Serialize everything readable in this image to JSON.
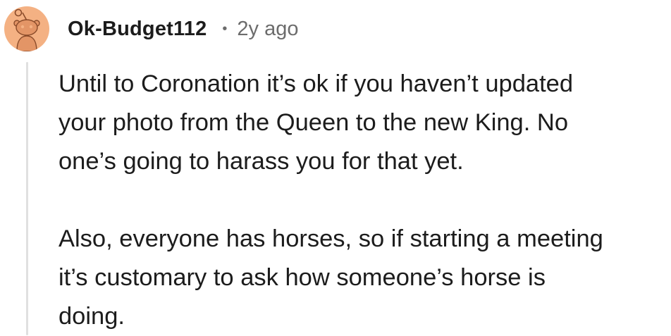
{
  "comment": {
    "author": "Ok-Budget112",
    "separator": "•",
    "timestamp": "2y ago",
    "avatar_icon": "reddit-snoo-avatar-icon",
    "avatar_color": "#f4b183",
    "paragraphs": [
      {
        "lines": [
          "Until to Coronation it’s ok if you haven’t updated",
          "your photo from the Queen to the new King. No",
          "one’s going to harass you for that yet."
        ]
      },
      {
        "lines": [
          "Also, everyone has horses, so if starting a meeting",
          "it’s customary to ask how someone’s horse is",
          "doing."
        ]
      }
    ]
  }
}
